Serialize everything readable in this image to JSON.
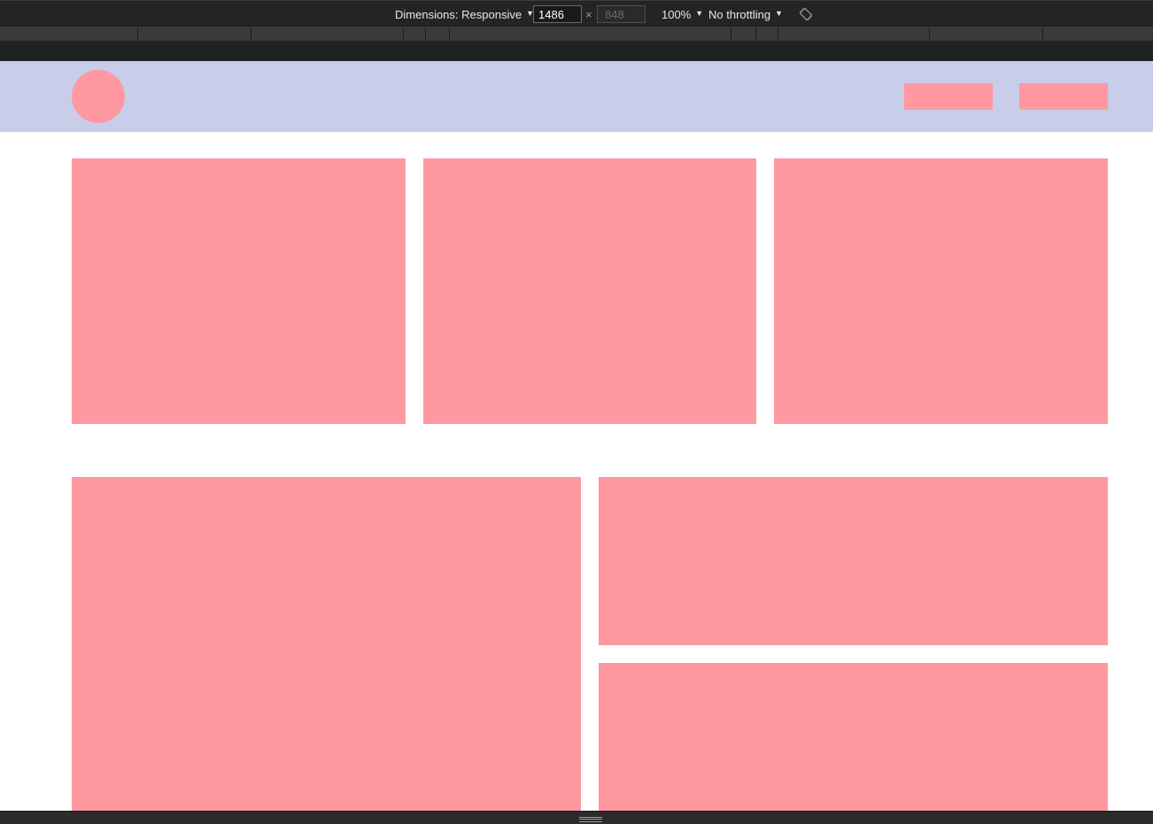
{
  "toolbar": {
    "dimensions_label": "Dimensions: Responsive",
    "width_value": "1486",
    "times_sign": "×",
    "height_placeholder": "848",
    "zoom_label": "100%",
    "throttling_label": "No throttling",
    "dropdown_caret": "▼",
    "rotate_icon": "rotate-icon"
  },
  "colors": {
    "toolbar_bg": "#242424",
    "header_bg": "#c8cde9",
    "placeholder_block": "#ff98a0",
    "page_bg": "#ffffff"
  }
}
